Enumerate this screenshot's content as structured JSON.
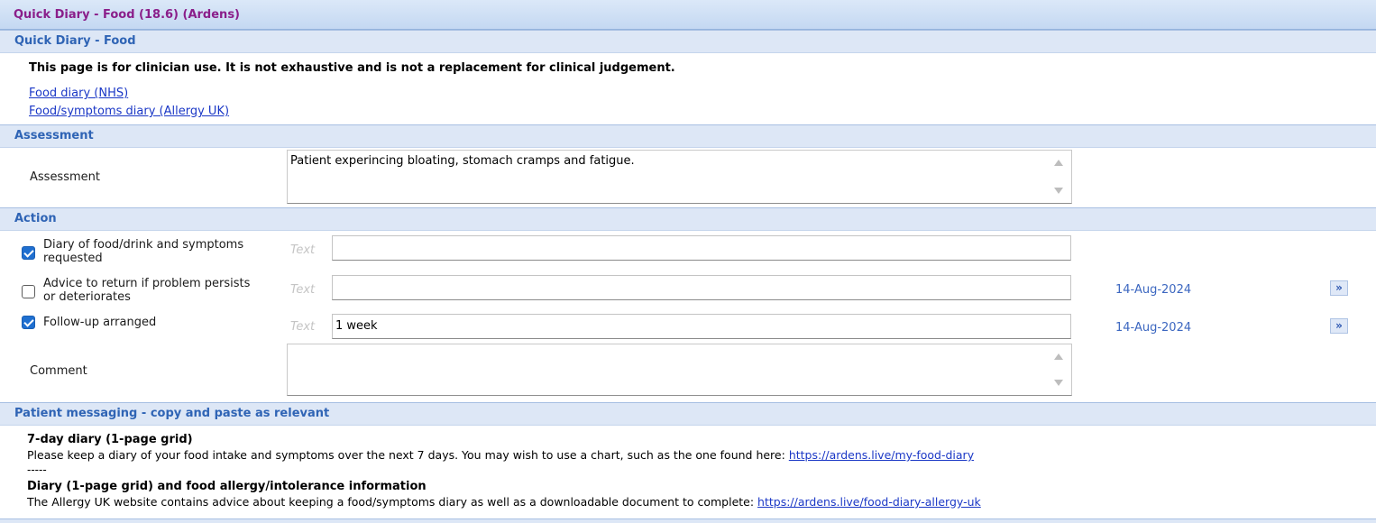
{
  "window": {
    "title": "Quick Diary - Food (18.6) (Ardens)"
  },
  "intro": {
    "header": "Quick Diary - Food",
    "disclaimer": "This page is for clinician use. It is not exhaustive and is not a replacement for clinical judgement.",
    "links": [
      "Food diary (NHS)",
      "Food/symptoms diary (Allergy UK)"
    ]
  },
  "assessment": {
    "header": "Assessment",
    "label": "Assessment",
    "value": "Patient experincing bloating, stomach cramps and fatigue."
  },
  "action": {
    "header": "Action",
    "text_placeholder": "Text",
    "items": [
      {
        "label_line1": "Diary of food/drink and symptoms",
        "label_line2": "requested",
        "checked": true,
        "text": "",
        "date": ""
      },
      {
        "label_line1": "Advice to return if problem persists",
        "label_line2": "or deteriorates",
        "checked": false,
        "text": "",
        "date": "14-Aug-2024"
      },
      {
        "label_line1": "Follow-up arranged",
        "label_line2": "",
        "checked": true,
        "text": "1 week",
        "date": "14-Aug-2024"
      }
    ],
    "comment_label": "Comment",
    "comment_value": "",
    "forward_glyph": "»"
  },
  "messaging": {
    "header": "Patient messaging - copy and paste as relevant",
    "block1_title": "7-day diary (1-page grid)",
    "block1_text": "Please keep a diary of your food intake and symptoms over the next 7 days. You may wish to use a chart, such as the one found here: ",
    "block1_link": "https://ardens.live/my-food-diary",
    "separator": "-----",
    "block2_title": "Diary (1-page grid) and food allergy/intolerance information",
    "block2_text": "The Allergy UK website contains advice about keeping a food/symptoms diary as well as a downloadable document to complete: ",
    "block2_link": "https://ardens.live/food-diary-allergy-uk"
  }
}
